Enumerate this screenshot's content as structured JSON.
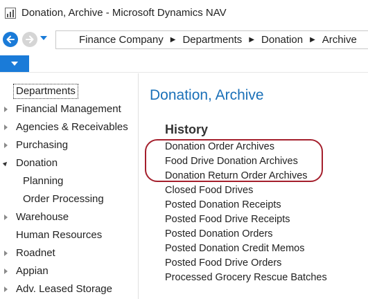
{
  "window": {
    "title": "Donation, Archive - Microsoft Dynamics NAV"
  },
  "navigation": {
    "breadcrumbs": [
      "Finance Company",
      "Departments",
      "Donation",
      "Archive"
    ]
  },
  "sidebar": {
    "items": [
      {
        "label": "Departments",
        "state": "selected"
      },
      {
        "label": "Financial Management",
        "state": "collapsed"
      },
      {
        "label": "Agencies & Receivables",
        "state": "collapsed"
      },
      {
        "label": "Purchasing",
        "state": "collapsed"
      },
      {
        "label": "Donation",
        "state": "expanded"
      },
      {
        "label": "Planning",
        "state": "child"
      },
      {
        "label": "Order Processing",
        "state": "child"
      },
      {
        "label": "Warehouse",
        "state": "collapsed"
      },
      {
        "label": "Human Resources",
        "state": "none"
      },
      {
        "label": "Roadnet",
        "state": "collapsed"
      },
      {
        "label": "Appian",
        "state": "collapsed"
      },
      {
        "label": "Adv. Leased Storage",
        "state": "collapsed"
      }
    ]
  },
  "main": {
    "page_title": "Donation, Archive",
    "section_title": "History",
    "links": [
      "Donation Order Archives",
      "Food Drive Donation Archives",
      "Donation Return Order Archives",
      "Closed Food Drives",
      "Posted Donation Receipts",
      "Posted Food Drive Receipts",
      "Posted Donation Orders",
      "Posted Donation Credit Memos",
      "Posted Food Drive Orders",
      "Processed Grocery Rescue Batches"
    ]
  },
  "colors": {
    "accent": "#1a7bd8",
    "title_blue": "#1a70b8",
    "highlight": "#a41f2c"
  }
}
